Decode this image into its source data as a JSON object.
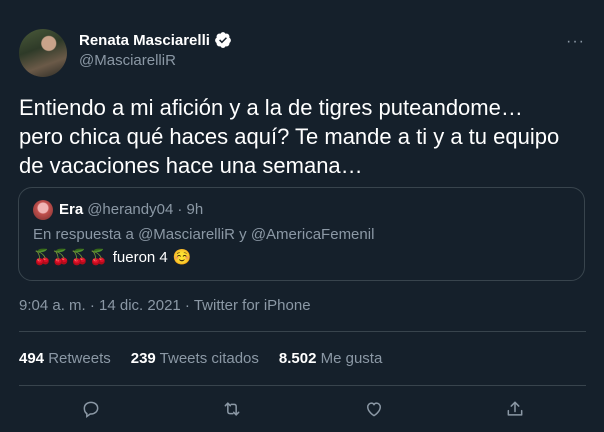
{
  "author": {
    "name": "Renata Masciarelli",
    "handle": "@MasciarelliR",
    "verified": true
  },
  "more_label": "···",
  "tweet": {
    "text": "Entiendo a mi afición y a la de tigres puteandome…\npero chica qué haces aquí? Te mande a ti y a tu equipo\nde vacaciones hace una semana…"
  },
  "quote": {
    "name": "Era",
    "handle": "@herandy04",
    "time": "· 9h",
    "reply_prefix": "En respuesta a",
    "reply_users": "@MasciarelliR y @AmericaFemenil",
    "body_emoji": "🍒🍒🍒🍒",
    "body_text": "fueron 4",
    "body_emoji_end": "☺️"
  },
  "meta": "9:04 a. m. · 14 dic. 2021 · Twitter for iPhone",
  "stats": {
    "retweets": "494",
    "retweets_label": "Retweets",
    "quotes": "239",
    "quotes_label": "Tweets citados",
    "likes": "8.502",
    "likes_label": "Me gusta"
  },
  "colors": {
    "background": "#15202b",
    "secondary_text": "#8b98a5",
    "verified_badge": "#ffffff",
    "border": "#38444d"
  },
  "icons": [
    "reply-icon",
    "retweet-icon",
    "like-icon",
    "share-icon"
  ]
}
